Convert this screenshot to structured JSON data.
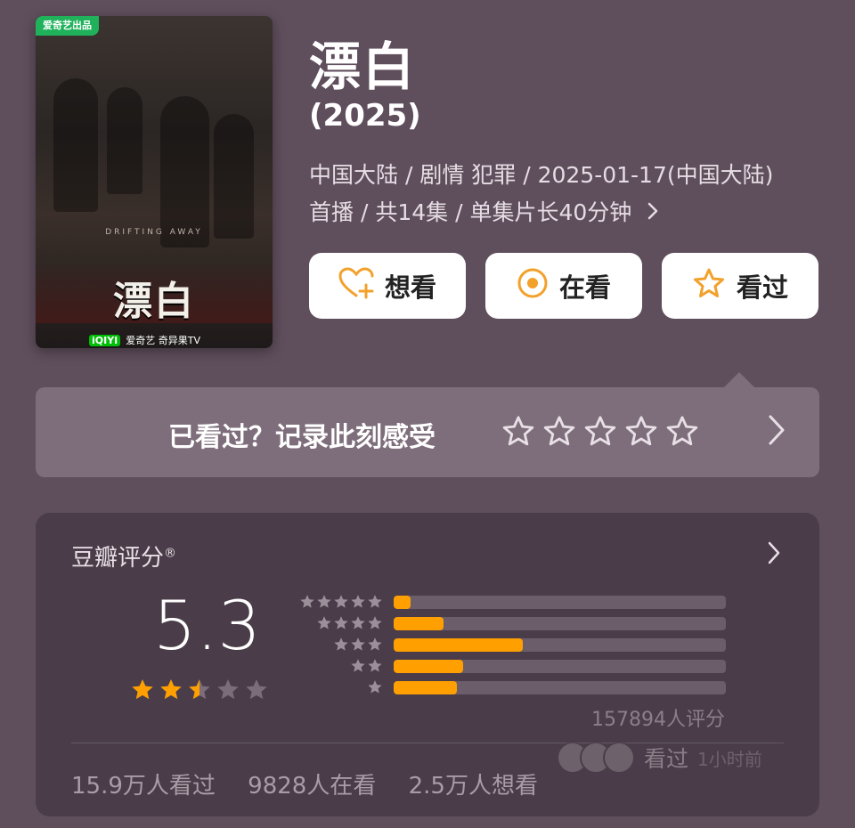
{
  "poster": {
    "badge": "爱奇艺出品",
    "title": "漂白",
    "subtitle": "DRIFTING AWAY",
    "platform_logo": "iQIYI",
    "platform_text": "爱奇艺  奇异果TV"
  },
  "movie": {
    "title": "漂白",
    "year": "(2025)",
    "meta_line1": "中国大陆 / 剧情 犯罪 / 2025-01-17(中国大陆)",
    "meta_line2": "首播 / 共14集 / 单集片长40分钟"
  },
  "actions": {
    "want_label": "想看",
    "watching_label": "在看",
    "watched_label": "看过"
  },
  "rate_prompt": {
    "text": "已看过？记录此刻感受"
  },
  "rating": {
    "label": "豆瓣评分",
    "registered": "®",
    "score": "5.3",
    "stars_value": 2.5,
    "distribution": [
      {
        "stars": 5,
        "percent": 5
      },
      {
        "stars": 4,
        "percent": 15
      },
      {
        "stars": 3,
        "percent": 39
      },
      {
        "stars": 2,
        "percent": 21
      },
      {
        "stars": 1,
        "percent": 19
      }
    ],
    "count_text": "157894人评分",
    "watched_text": "15.9万人看过",
    "watching_text": "9828人在看",
    "want_text": "2.5万人想看",
    "friends_label": "看过",
    "friends_time": "1小时前"
  },
  "colors": {
    "background": "#5f4e5c",
    "accent": "#ff9f00",
    "card": "#4a3d49"
  },
  "icons": {
    "want": "heart-plus-icon",
    "watching": "target-circle-icon",
    "watched": "star-outline-icon"
  }
}
